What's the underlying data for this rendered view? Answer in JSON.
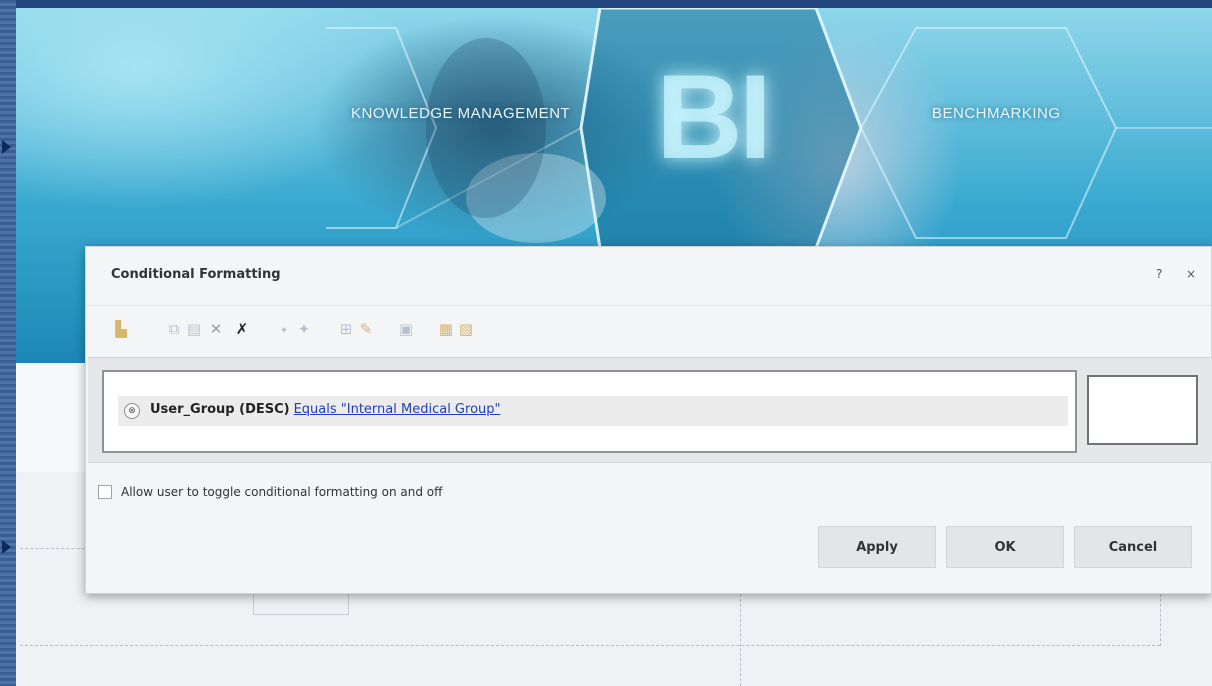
{
  "banner": {
    "caption_left": "KNOWLEDGE MANAGEMENT",
    "caption_right": "BENCHMARKING",
    "center_text": "BI"
  },
  "dialog": {
    "title": "Conditional Formatting",
    "help_label": "?",
    "close_label": "×",
    "toolbar": [
      {
        "icon": "new-condition-icon"
      },
      {
        "icon": "copy-icon"
      },
      {
        "icon": "paste-icon"
      },
      {
        "icon": "delete-icon"
      },
      {
        "icon": "clear-all-icon"
      },
      {
        "icon": "move-up-icon"
      },
      {
        "icon": "move-down-icon"
      },
      {
        "icon": "group-icon"
      },
      {
        "icon": "ungroup-icon"
      },
      {
        "icon": "format-icon"
      },
      {
        "icon": "import-icon"
      },
      {
        "icon": "export-icon"
      }
    ],
    "condition": {
      "toggle_symbol": "⊗",
      "field": "User_Group (DESC)",
      "link": "Equals \"Internal Medical Group\""
    },
    "allow_toggle_label": "Allow user to toggle conditional formatting on and off",
    "buttons": {
      "apply": "Apply",
      "ok": "OK",
      "cancel": "Cancel"
    }
  },
  "colors": {
    "frame": "#24477f",
    "banner_cyan": "#3aa9d0",
    "link": "#1f3fb8",
    "dialog_bg": "#f4f5f6"
  }
}
